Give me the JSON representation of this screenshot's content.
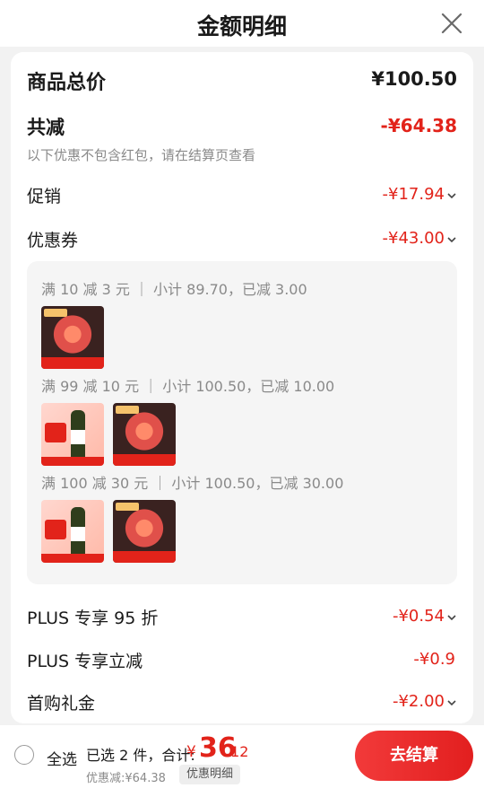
{
  "header": {
    "title": "金额明细",
    "close_icon": "close-icon"
  },
  "total": {
    "label": "商品总价",
    "value": "¥100.50"
  },
  "discount": {
    "label": "共减",
    "value": "-¥64.38",
    "note": "以下优惠不包含红包，请在结算页查看"
  },
  "promo": {
    "label": "促销",
    "value": "-¥17.94"
  },
  "coupon": {
    "label": "优惠券",
    "value": "-¥43.00"
  },
  "tiers": [
    {
      "text": "满 10 减 3 元 ｜ 小计 89.70，已减 3.00",
      "items": [
        "sausage"
      ]
    },
    {
      "text": "满 99 减 10 元 ｜ 小计 100.50，已减 10.00",
      "items": [
        "sauce",
        "sausage"
      ]
    },
    {
      "text": "满 100 减 30 元 ｜ 小计 100.50，已减 30.00",
      "items": [
        "sauce",
        "sausage"
      ]
    }
  ],
  "plus95": {
    "label": "PLUS 专享 95 折",
    "value": "-¥0.54"
  },
  "plus_instant": {
    "label": "PLUS 专享立减",
    "value": "-¥0.9"
  },
  "first_gift": {
    "label": "首购礼金",
    "value": "-¥2.00"
  },
  "bottom": {
    "select_all": "全选",
    "selected_info": "已选 2 件，合计:",
    "currency": "¥",
    "sum_integer": "36",
    "sum_decimal": ".12",
    "discount_line": "优惠减:¥64.38",
    "detail_label": "优惠明细",
    "checkout_label": "去结算"
  },
  "colors": {
    "accent": "#e2231a",
    "muted": "#8a8a8a",
    "panel": "#f5f5f5"
  }
}
